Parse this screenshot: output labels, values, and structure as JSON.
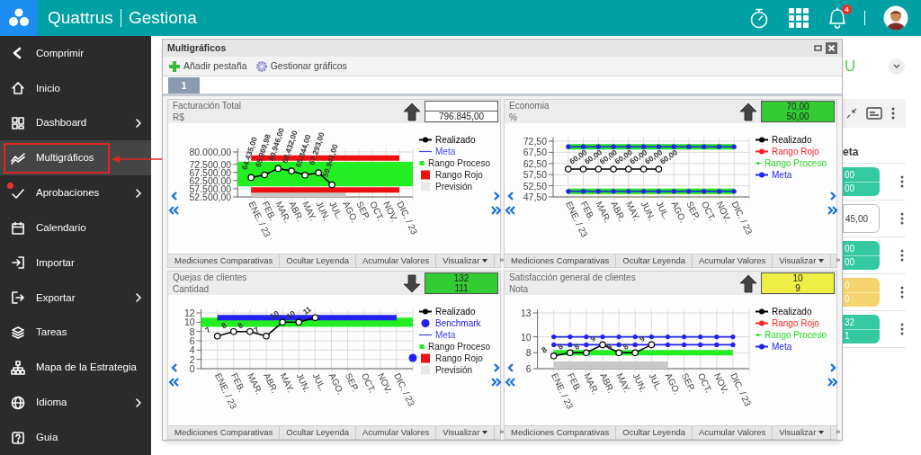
{
  "app": {
    "brand": "Quattrus",
    "product": "Gestiona",
    "notifications": "4"
  },
  "sidebar": {
    "items": [
      {
        "label": "Comprimir",
        "selected": false,
        "submenu": false,
        "alert": false
      },
      {
        "label": "Inicio",
        "selected": false,
        "submenu": false,
        "alert": false
      },
      {
        "label": "Dashboard",
        "selected": false,
        "submenu": true,
        "alert": false
      },
      {
        "label": "Multigráficos",
        "selected": true,
        "submenu": false,
        "alert": false
      },
      {
        "label": "Aprobaciones",
        "selected": false,
        "submenu": true,
        "alert": true
      },
      {
        "label": "Calendario",
        "selected": false,
        "submenu": false,
        "alert": false
      },
      {
        "label": "Importar",
        "selected": false,
        "submenu": false,
        "alert": false
      },
      {
        "label": "Exportar",
        "selected": false,
        "submenu": true,
        "alert": false
      },
      {
        "label": "Tareas",
        "selected": false,
        "submenu": false,
        "alert": false
      },
      {
        "label": "Mapa de la Estrategia",
        "selected": false,
        "submenu": false,
        "alert": false
      },
      {
        "label": "Idioma",
        "selected": false,
        "submenu": true,
        "alert": false
      },
      {
        "label": "Guia",
        "selected": false,
        "submenu": false,
        "alert": false
      }
    ]
  },
  "background_view": {
    "heading": "U",
    "column_heading": "eta",
    "cards": [
      {
        "color": "#34c9a0",
        "lines": [
          "00",
          "00"
        ]
      },
      {
        "color": "#ffffff",
        "lines": [
          "45,00"
        ]
      },
      {
        "color": "#34c9a0",
        "lines": [
          "00",
          "00"
        ]
      },
      {
        "color": "#f5d36e",
        "lines": [
          "0",
          "0"
        ]
      },
      {
        "color": "#34c9a0",
        "lines": [
          "32",
          "1"
        ]
      }
    ]
  },
  "dialog": {
    "title": "Multigráficos",
    "toolbar": [
      "Añadir pestaña",
      "Gestionar gráficos"
    ],
    "tabs": [
      {
        "label": "1",
        "selected": true
      }
    ],
    "panels": [
      {
        "title": "Facturación Total",
        "unit": "R$",
        "rising": true,
        "indicator": {
          "lines": [
            "796.845,00"
          ]
        },
        "chart_data": {
          "type": "line",
          "grid": true,
          "categories": [
            "ENE. / 23",
            "FEB.",
            "MAR.",
            "ABR.",
            "MAY.",
            "JUN.",
            "JUL.",
            "AGO.",
            "SEP.",
            "OCT.",
            "NOV.",
            "DIC. / 23"
          ],
          "ylim": [
            52500,
            80000
          ],
          "yticks": [
            {
              "value": 52500,
              "label": "52.500,00"
            },
            {
              "value": 57500,
              "label": "57.500,00"
            },
            {
              "value": 62500,
              "label": "62.500,00"
            },
            {
              "value": 67500,
              "label": "67.500,00"
            },
            {
              "value": 72500,
              "label": "72.500,00"
            },
            {
              "value": 80000,
              "label": "80.000,00"
            }
          ],
          "bands": [
            {
              "axis": "y",
              "from": 59000,
              "to": 74000,
              "color": "#22ee22"
            }
          ],
          "series": [
            {
              "type": "area",
              "color": "#c8c8c8",
              "values": [
                56300,
                56300,
                56300,
                56300,
                56300,
                56300,
                56300,
                56300,
                null,
                null,
                null,
                null
              ]
            },
            {
              "type": "line",
              "marker": false,
              "color": "#ee1111",
              "values": [
                76300,
                76300,
                76300,
                76300,
                76300,
                76300,
                76300,
                76300,
                76300,
                76300,
                76300,
                76300
              ]
            },
            {
              "type": "line",
              "marker": false,
              "color": "#ee1111",
              "values": [
                56800,
                56800,
                56800,
                56800,
                56800,
                56800,
                56800,
                56800,
                56800,
                56800,
                56800,
                56800
              ]
            },
            {
              "type": "line",
              "marker": true,
              "color": "#000000",
              "values": [
                64400,
                66000,
                69900,
                68400,
                65800,
                67300,
                59900,
                null,
                null,
                null,
                null,
                null
              ]
            }
          ],
          "value_labels": [
            "64.435,00",
            "65.969,98",
            "69.946,00",
            "68.432,00",
            "65.844,00",
            "67.293,00",
            "59.941,00"
          ]
        },
        "legend": [
          {
            "label": "Realizado",
            "kind": "marker",
            "color": "#000000"
          },
          {
            "label": "Meta",
            "kind": "line",
            "color": "#4444ee"
          },
          {
            "label": "Rango Proceso",
            "kind": "square",
            "color": "#22ee22"
          },
          {
            "label": "Rango Rojo",
            "kind": "square",
            "color": "#ee1111"
          },
          {
            "label": "Previsión",
            "kind": "square",
            "color": "#e8e8e8"
          }
        ],
        "actions": [
          "Mediciones Comparativas",
          "Ocultar Leyenda",
          "Acumular Valores",
          "Visualizar"
        ],
        "more": "»"
      },
      {
        "title": "Economia",
        "unit": "%",
        "rising": true,
        "indicator": {
          "color": "#33cc33",
          "lines": [
            "70,00",
            "50,00"
          ]
        },
        "chart_data": {
          "type": "line",
          "grid": true,
          "categories": [
            "ENE. / 23",
            "FEB.",
            "MAR.",
            "ABR.",
            "MAY.",
            "JUN.",
            "JUL.",
            "AGO.",
            "SEP.",
            "OCT.",
            "NOV.",
            "DIC. / 23"
          ],
          "ylim": [
            47.5,
            72.5
          ],
          "yticks": [
            {
              "value": 47.5,
              "label": "47,50"
            },
            {
              "value": 52.5,
              "label": "52,50"
            },
            {
              "value": 57.5,
              "label": "57,50"
            },
            {
              "value": 62.5,
              "label": "62,50"
            },
            {
              "value": 67.5,
              "label": "67,50"
            },
            {
              "value": 72.5,
              "label": "72,50"
            }
          ],
          "series": [
            {
              "type": "line",
              "marker": false,
              "color": "#22dd22",
              "values": [
                70,
                70,
                70,
                70,
                70,
                70,
                70,
                70,
                70,
                70,
                70,
                70
              ]
            },
            {
              "type": "line",
              "marker": false,
              "color": "#22dd22",
              "values": [
                50,
                50,
                50,
                50,
                50,
                50,
                50,
                50,
                50,
                50,
                50,
                50
              ]
            },
            {
              "type": "line",
              "marker": true,
              "color": "#2222ee",
              "values": [
                70,
                70,
                70,
                70,
                70,
                70,
                70,
                70,
                70,
                70,
                70,
                70
              ]
            },
            {
              "type": "line",
              "marker": true,
              "color": "#2222ee",
              "values": [
                50,
                50,
                50,
                50,
                50,
                50,
                50,
                50,
                50,
                50,
                50,
                50
              ]
            },
            {
              "type": "line",
              "marker": true,
              "color": "#000000",
              "values": [
                60,
                60,
                60,
                60,
                60,
                60,
                60,
                null,
                null,
                null,
                null,
                null
              ]
            }
          ],
          "value_labels": [
            "60,00",
            "60,00",
            "60,00",
            "60,00",
            "60,00",
            "60,00",
            "60,00"
          ]
        },
        "legend": [
          {
            "label": "Realizado",
            "kind": "marker",
            "color": "#000000"
          },
          {
            "label": "Rango Rojo",
            "kind": "marker",
            "color": "#ff2222"
          },
          {
            "label": "Rango Proceso",
            "kind": "marker",
            "color": "#22dd22"
          },
          {
            "label": "Meta",
            "kind": "marker",
            "color": "#2222ee"
          }
        ],
        "actions": [
          "Mediciones Comparativas",
          "Ocultar Leyenda",
          "Acumular Valores",
          "Visualizar"
        ],
        "more": "»"
      },
      {
        "title": "Quejas de clientes",
        "unit": "Cantidad",
        "rising": false,
        "indicator": {
          "color": "#33cc33",
          "lines": [
            "132",
            "111"
          ]
        },
        "chart_data": {
          "type": "line",
          "grid": true,
          "categories": [
            "ENE. / 23",
            "FEB.",
            "MAR.",
            "ABR.",
            "MAY.",
            "JUN.",
            "JUL.",
            "AGO.",
            "SEP.",
            "OCT.",
            "NOV.",
            "DIC. / 23"
          ],
          "ylim": [
            0,
            12
          ],
          "yticks": [
            0,
            2,
            4,
            6,
            8,
            10,
            12
          ],
          "bands": [
            {
              "axis": "y",
              "from": 9,
              "to": 11,
              "color": "#22ee22"
            }
          ],
          "series": [
            {
              "type": "line",
              "marker": false,
              "color": "#2222ee",
              "values": [
                11,
                11,
                11,
                11,
                11,
                11,
                11,
                11,
                11,
                11,
                11,
                11
              ]
            },
            {
              "type": "line",
              "marker": true,
              "color": "#000000",
              "values": [
                7,
                8,
                8,
                7,
                10,
                10,
                11,
                null,
                null,
                null,
                null,
                null
              ]
            }
          ],
          "value_labels": [
            "7",
            "8",
            "8",
            "7",
            "10",
            "10",
            "11"
          ]
        },
        "legend": [
          {
            "label": "Realizado",
            "kind": "marker",
            "color": "#000000"
          },
          {
            "label": "Benchmark",
            "kind": "dot",
            "color": "#2222ee"
          },
          {
            "label": "Meta",
            "kind": "line",
            "color": "#4444ee"
          },
          {
            "label": "Rango Proceso",
            "kind": "square",
            "color": "#22ee22"
          },
          {
            "label": "Rango Rojo",
            "kind": "square",
            "color": "#ee1111"
          },
          {
            "label": "Previsión",
            "kind": "square",
            "color": "#e8e8e8"
          }
        ],
        "actions": [
          "Mediciones Comparativas",
          "Ocultar Leyenda",
          "Acumular Valores",
          "Visualizar"
        ],
        "more": "»"
      },
      {
        "title": "Satisfacción general de clientes",
        "unit": "Nota",
        "rising": true,
        "indicator": {
          "color": "#eeee44",
          "lines": [
            "10",
            "9"
          ]
        },
        "chart_data": {
          "type": "line",
          "grid": true,
          "categories": [
            "ENE. / 23",
            "FEB.",
            "MAR.",
            "ABR.",
            "MAY.",
            "JUN.",
            "JUL.",
            "AGO.",
            "SEP.",
            "OCT.",
            "NOV.",
            "DIC. / 23"
          ],
          "ylim": [
            6,
            13
          ],
          "yticks": [
            6,
            8,
            10,
            13
          ],
          "series": [
            {
              "type": "area",
              "color": "#c8c8c8",
              "values": [
                6.9,
                6.9,
                6.9,
                6.9,
                6.9,
                6.9,
                6.9,
                6.9,
                null,
                null,
                null,
                null
              ]
            },
            {
              "type": "line",
              "marker": false,
              "color": "#22ee22",
              "values": [
                8,
                8,
                8,
                8,
                8,
                8,
                8,
                8,
                8,
                8,
                8,
                8
              ]
            },
            {
              "type": "line",
              "marker": true,
              "color": "#2222ee",
              "values": [
                10,
                10,
                10,
                10,
                10,
                10,
                10,
                10,
                10,
                10,
                10,
                10
              ]
            },
            {
              "type": "line",
              "marker": true,
              "color": "#2222ee",
              "values": [
                9,
                9,
                9,
                9,
                9,
                9,
                9,
                9,
                9,
                9,
                9,
                9
              ]
            },
            {
              "type": "line",
              "marker": true,
              "color": "#000000",
              "values": [
                7.6,
                8,
                8,
                9,
                8,
                8,
                9,
                null,
                null,
                null,
                null,
                null
              ]
            }
          ],
          "value_labels": [
            "8",
            "8",
            "8",
            "9",
            "8",
            "8",
            "9"
          ]
        },
        "legend": [
          {
            "label": "Realizado",
            "kind": "marker",
            "color": "#000000"
          },
          {
            "label": "Rango Rojo",
            "kind": "marker",
            "color": "#ff2222"
          },
          {
            "label": "Rango Proceso",
            "kind": "marker",
            "color": "#22dd22"
          },
          {
            "label": "Meta",
            "kind": "marker",
            "color": "#2222ee"
          }
        ],
        "actions": [
          "Mediciones Comparativas",
          "Ocultar Leyenda",
          "Acumular Valores",
          "Visualizar"
        ],
        "more": "»"
      }
    ]
  }
}
